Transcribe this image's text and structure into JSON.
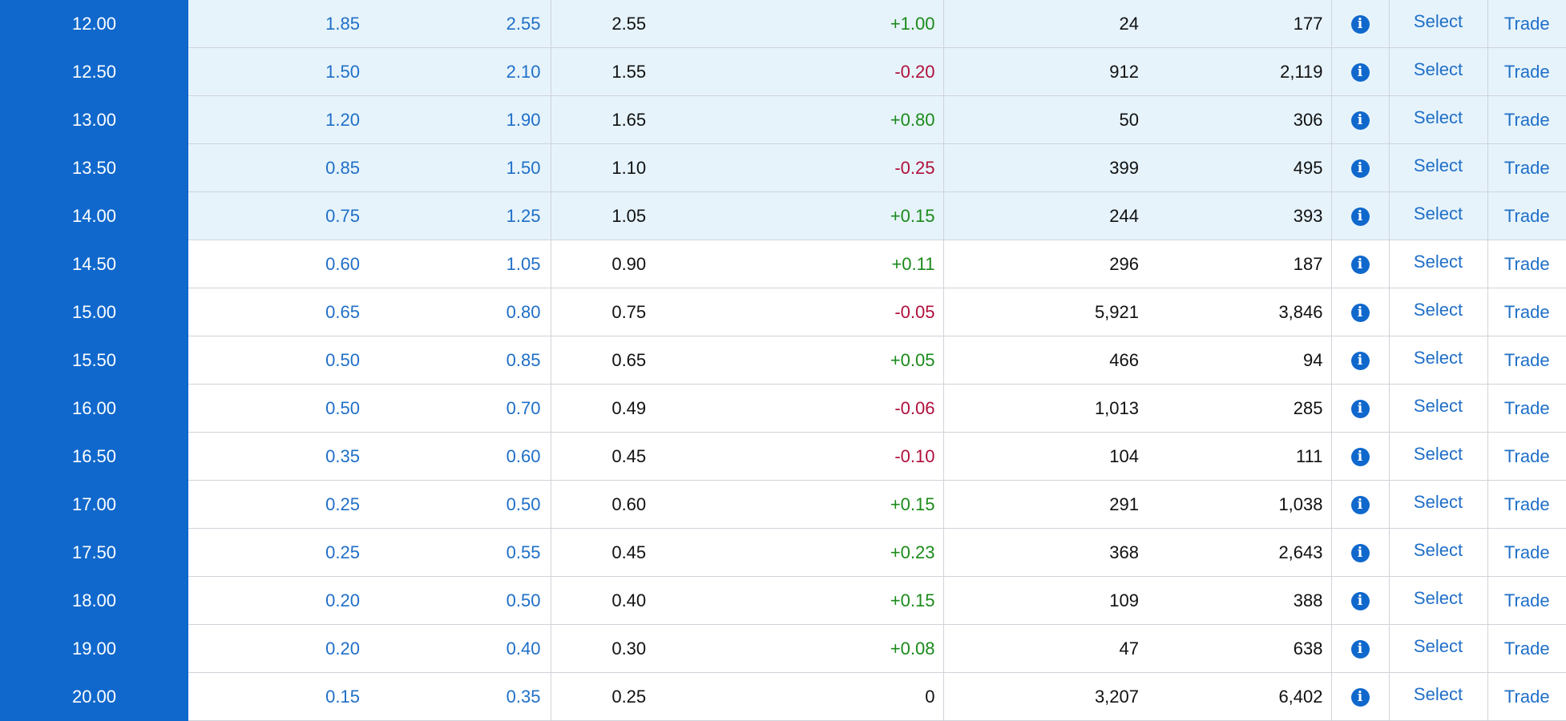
{
  "colors": {
    "strike_bg": "#1068cc",
    "itm_row_bg": "#e6f3fb",
    "link_blue": "#1f6fc7",
    "positive": "#1a8a1a",
    "negative": "#b0103a"
  },
  "icons": {
    "info": "info-circle-icon"
  },
  "info_glyph": "i",
  "rows": [
    {
      "strike": "12.00",
      "bid": "1.85",
      "ask": "2.55",
      "last": "2.55",
      "change": "+1.00",
      "volume": "24",
      "open_interest": "177",
      "select": "Select",
      "trade": "Trade"
    },
    {
      "strike": "12.50",
      "bid": "1.50",
      "ask": "2.10",
      "last": "1.55",
      "change": "-0.20",
      "volume": "912",
      "open_interest": "2,119",
      "select": "Select",
      "trade": "Trade"
    },
    {
      "strike": "13.00",
      "bid": "1.20",
      "ask": "1.90",
      "last": "1.65",
      "change": "+0.80",
      "volume": "50",
      "open_interest": "306",
      "select": "Select",
      "trade": "Trade"
    },
    {
      "strike": "13.50",
      "bid": "0.85",
      "ask": "1.50",
      "last": "1.10",
      "change": "-0.25",
      "volume": "399",
      "open_interest": "495",
      "select": "Select",
      "trade": "Trade"
    },
    {
      "strike": "14.00",
      "bid": "0.75",
      "ask": "1.25",
      "last": "1.05",
      "change": "+0.15",
      "volume": "244",
      "open_interest": "393",
      "select": "Select",
      "trade": "Trade"
    },
    {
      "strike": "14.50",
      "bid": "0.60",
      "ask": "1.05",
      "last": "0.90",
      "change": "+0.11",
      "volume": "296",
      "open_interest": "187",
      "select": "Select",
      "trade": "Trade"
    },
    {
      "strike": "15.00",
      "bid": "0.65",
      "ask": "0.80",
      "last": "0.75",
      "change": "-0.05",
      "volume": "5,921",
      "open_interest": "3,846",
      "select": "Select",
      "trade": "Trade"
    },
    {
      "strike": "15.50",
      "bid": "0.50",
      "ask": "0.85",
      "last": "0.65",
      "change": "+0.05",
      "volume": "466",
      "open_interest": "94",
      "select": "Select",
      "trade": "Trade"
    },
    {
      "strike": "16.00",
      "bid": "0.50",
      "ask": "0.70",
      "last": "0.49",
      "change": "-0.06",
      "volume": "1,013",
      "open_interest": "285",
      "select": "Select",
      "trade": "Trade"
    },
    {
      "strike": "16.50",
      "bid": "0.35",
      "ask": "0.60",
      "last": "0.45",
      "change": "-0.10",
      "volume": "104",
      "open_interest": "111",
      "select": "Select",
      "trade": "Trade"
    },
    {
      "strike": "17.00",
      "bid": "0.25",
      "ask": "0.50",
      "last": "0.60",
      "change": "+0.15",
      "volume": "291",
      "open_interest": "1,038",
      "select": "Select",
      "trade": "Trade"
    },
    {
      "strike": "17.50",
      "bid": "0.25",
      "ask": "0.55",
      "last": "0.45",
      "change": "+0.23",
      "volume": "368",
      "open_interest": "2,643",
      "select": "Select",
      "trade": "Trade"
    },
    {
      "strike": "18.00",
      "bid": "0.20",
      "ask": "0.50",
      "last": "0.40",
      "change": "+0.15",
      "volume": "109",
      "open_interest": "388",
      "select": "Select",
      "trade": "Trade"
    },
    {
      "strike": "19.00",
      "bid": "0.20",
      "ask": "0.40",
      "last": "0.30",
      "change": "+0.08",
      "volume": "47",
      "open_interest": "638",
      "select": "Select",
      "trade": "Trade"
    },
    {
      "strike": "20.00",
      "bid": "0.15",
      "ask": "0.35",
      "last": "0.25",
      "change": "0",
      "volume": "3,207",
      "open_interest": "6,402",
      "select": "Select",
      "trade": "Trade"
    }
  ]
}
